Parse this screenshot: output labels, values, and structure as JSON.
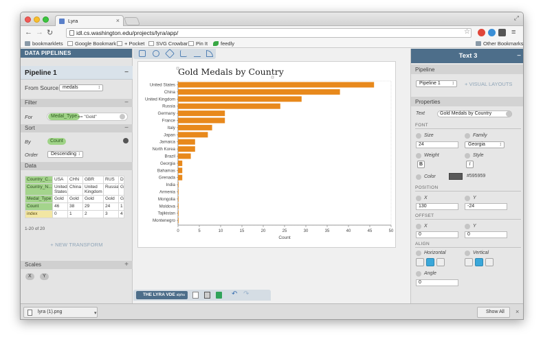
{
  "browser": {
    "tab_title": "Lyra",
    "url": "idl.cs.washington.edu/projects/lyra/app/",
    "bookmarks": [
      "bookmarklets",
      "Google Bookmark",
      "+ Pocket",
      "SVG Crowbar",
      "Pin It",
      "feedly"
    ],
    "other_bookmarks": "Other Bookmarks"
  },
  "left_panel": {
    "header": "DATA PIPELINES",
    "pipeline_title": "Pipeline 1",
    "from_source_label": "From Source:",
    "from_source_value": "medals",
    "filter_section": "Filter",
    "filter_for_label": "For",
    "filter_field": "Medal_Type",
    "filter_expr": "== \"Gold\"",
    "sort_section": "Sort",
    "sort_by_label": "By",
    "sort_by_value": "Count",
    "sort_order_label": "Order",
    "sort_order_value": "Descending",
    "data_section": "Data",
    "table": {
      "rows": [
        [
          "Country_C...",
          "USA",
          "CHN",
          "GBR",
          "RUS",
          "D"
        ],
        [
          "Country_N...",
          "United States",
          "China",
          "United Kingdom",
          "Russia",
          "G"
        ],
        [
          "Medal_Type",
          "Gold",
          "Gold",
          "Gold",
          "Gold",
          "G"
        ],
        [
          "Count",
          "46",
          "38",
          "29",
          "24",
          "1"
        ],
        [
          "index",
          "0",
          "1",
          "2",
          "3",
          "4"
        ]
      ]
    },
    "pager": "1-20 of 20",
    "new_transform": "+ NEW TRANSFORM",
    "scales_section": "Scales",
    "scales": [
      "X",
      "Y"
    ]
  },
  "chart_data": {
    "type": "bar",
    "title": "Gold Medals by Country",
    "xlabel": "Count",
    "ylabel": "",
    "xlim": [
      0,
      50
    ],
    "xticks": [
      0,
      5,
      10,
      15,
      20,
      25,
      30,
      35,
      40,
      45,
      50
    ],
    "categories": [
      "United States",
      "China",
      "United Kingdom",
      "Russia",
      "Germany",
      "France",
      "Italy",
      "Japan",
      "Jamaica",
      "North Korea",
      "Brazil",
      "Georgia",
      "Bahamas",
      "Grenada",
      "India",
      "Armenia",
      "Mongolia",
      "Moldova",
      "Tajikistan",
      "Montenegro"
    ],
    "values": [
      46,
      38,
      29,
      24,
      11,
      11,
      8,
      7,
      4,
      4,
      3,
      1,
      1,
      1,
      0,
      0,
      0,
      0,
      0,
      0
    ],
    "bar_color": "#e8891c",
    "orientation": "horizontal"
  },
  "center": {
    "lyra_label": "THE LYRA VDE",
    "lyra_badge": "alpha"
  },
  "right_panel": {
    "header": "Text 3",
    "pipeline_section": "Pipeline",
    "pipeline_value": "Pipeline 1",
    "visual_layouts": "+ VISUAL LAYOUTS",
    "properties_section": "Properties",
    "text_label": "Text",
    "text_value": "Gold Medals by Country",
    "font_header": "FONT",
    "size_label": "Size",
    "size_value": "24",
    "family_label": "Family",
    "family_value": "Georgia",
    "weight_label": "Weight",
    "weight_btn": "B",
    "style_label": "Style",
    "style_btn": "I",
    "color_label": "Color",
    "color_value": "#595959",
    "position_header": "POSITION",
    "x_label": "X",
    "x_value": "130",
    "y_label": "Y",
    "y_value": "-24",
    "offset_header": "OFFSET",
    "ox_value": "0",
    "oy_value": "0",
    "align_header": "ALIGN",
    "horizontal_label": "Horizontal",
    "vertical_label": "Vertical",
    "angle_label": "Angle",
    "angle_value": "0"
  },
  "statusbar": {
    "download_name": "lyra (1).png",
    "show_all": "Show All"
  },
  "colors": {
    "accent": "#4d6e8a",
    "bar": "#e8891c",
    "pill_green": "#9fd387"
  }
}
